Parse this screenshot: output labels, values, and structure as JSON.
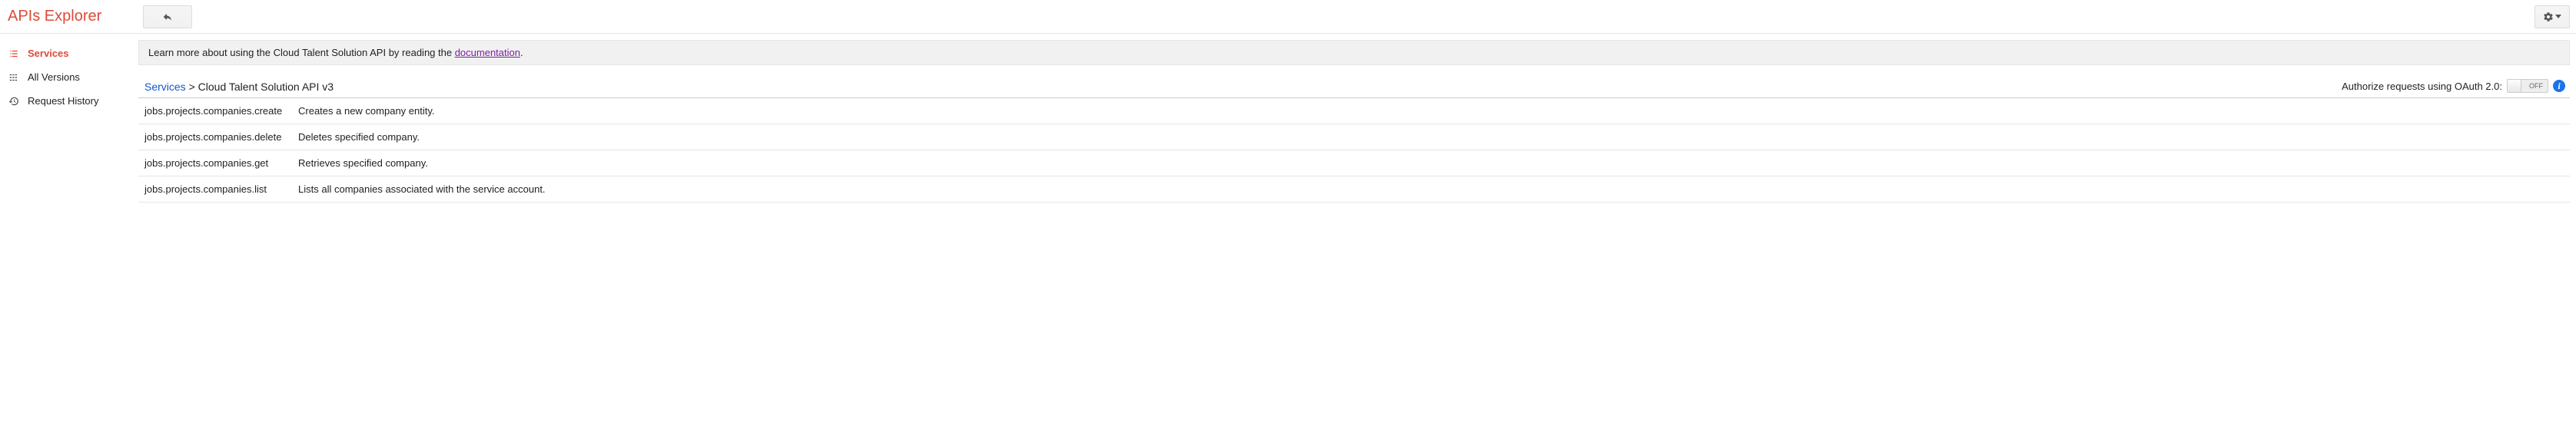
{
  "header": {
    "title": "APIs Explorer"
  },
  "sidebar": {
    "items": [
      {
        "label": "Services",
        "active": true
      },
      {
        "label": "All Versions",
        "active": false
      },
      {
        "label": "Request History",
        "active": false
      }
    ]
  },
  "info": {
    "prefix": "Learn more about using the Cloud Talent Solution API by reading the ",
    "link_text": "documentation",
    "suffix": "."
  },
  "breadcrumb": {
    "root": "Services",
    "sep": " > ",
    "current": "Cloud Talent Solution API v3"
  },
  "auth": {
    "label": "Authorize requests using OAuth 2.0:",
    "toggle_state": "OFF"
  },
  "methods": [
    {
      "name": "jobs.projects.companies.create",
      "desc": "Creates a new company entity."
    },
    {
      "name": "jobs.projects.companies.delete",
      "desc": "Deletes specified company."
    },
    {
      "name": "jobs.projects.companies.get",
      "desc": "Retrieves specified company."
    },
    {
      "name": "jobs.projects.companies.list",
      "desc": "Lists all companies associated with the service account."
    }
  ]
}
